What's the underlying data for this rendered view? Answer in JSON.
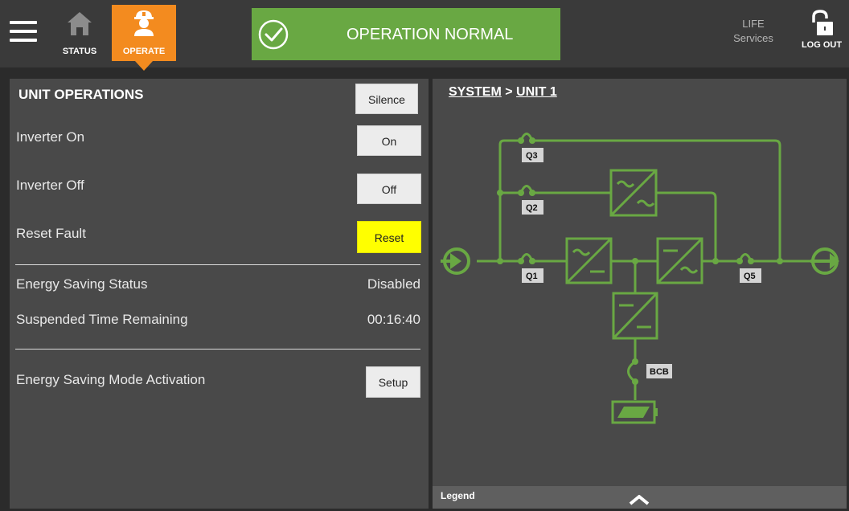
{
  "header": {
    "nav": {
      "status_label": "STATUS",
      "operate_label": "OPERATE"
    },
    "status_banner": {
      "message": "OPERATION NORMAL",
      "color": "#69a843"
    },
    "life_services": {
      "line1": "LIFE",
      "line2": "Services"
    },
    "logout_label": "LOG OUT",
    "accent_color": "#f38b1f"
  },
  "unit_operations": {
    "title": "UNIT OPERATIONS",
    "silence_label": "Silence",
    "rows": [
      {
        "label": "Inverter On",
        "button": "On"
      },
      {
        "label": "Inverter Off",
        "button": "Off"
      },
      {
        "label": "Reset Fault",
        "button": "Reset",
        "button_color": "#ffff00"
      }
    ],
    "energy_saving_status": {
      "label": "Energy Saving Status",
      "value": "Disabled"
    },
    "suspended_time": {
      "label": "Suspended Time Remaining",
      "value": "00:16:40"
    },
    "energy_saving_mode": {
      "label": "Energy Saving Mode Activation",
      "button": "Setup"
    }
  },
  "system_panel": {
    "breadcrumb": {
      "root": "SYSTEM",
      "separator": ">",
      "current": "UNIT 1"
    },
    "diagram": {
      "line_color": "#69a843",
      "switches": {
        "q3": "Q3",
        "q2": "Q2",
        "q1": "Q1",
        "q5": "Q5",
        "bcb": "BCB"
      }
    },
    "legend_label": "Legend"
  }
}
